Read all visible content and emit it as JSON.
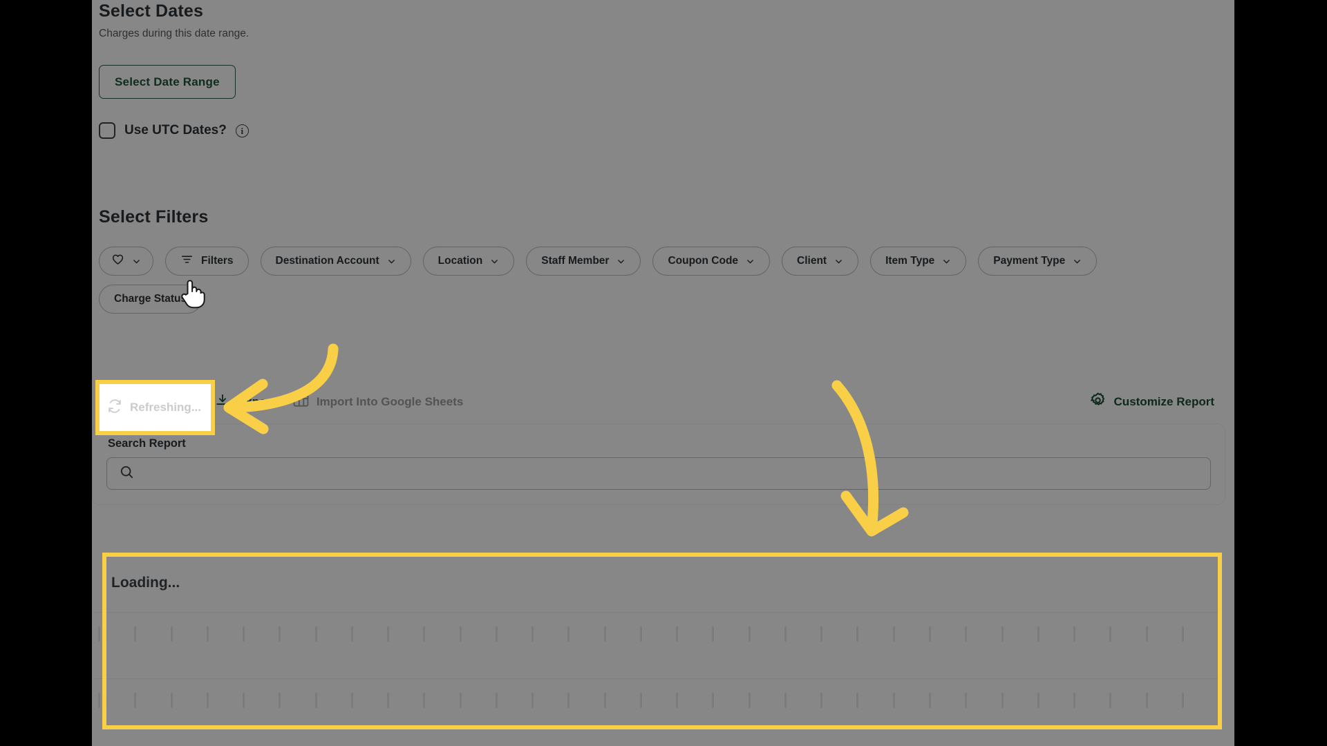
{
  "sections": {
    "dates": {
      "title": "Select Dates",
      "subtitle": "Charges during this date range.",
      "date_range_button": "Select Date Range",
      "utc_label": "Use UTC Dates?",
      "utc_checked": false,
      "info_glyph": "i"
    },
    "filters": {
      "title": "Select Filters",
      "pills": [
        {
          "label": "",
          "icon": "heart-icon",
          "chevron": true
        },
        {
          "label": "Filters",
          "icon": "filter-icon",
          "chevron": false
        },
        {
          "label": "Destination Account",
          "icon": "",
          "chevron": true
        },
        {
          "label": "Location",
          "icon": "",
          "chevron": true
        },
        {
          "label": "Staff Member",
          "icon": "",
          "chevron": true
        },
        {
          "label": "Coupon Code",
          "icon": "",
          "chevron": true
        },
        {
          "label": "Client",
          "icon": "",
          "chevron": true
        },
        {
          "label": "Item Type",
          "icon": "",
          "chevron": true
        },
        {
          "label": "Payment Type",
          "icon": "",
          "chevron": true
        },
        {
          "label": "Charge Status",
          "icon": "",
          "chevron": false
        }
      ]
    }
  },
  "toolbar": {
    "refreshing_label": "Refreshing...",
    "export_label": "Export",
    "sheets_label": "Import Into Google Sheets",
    "customize_label": "Customize Report"
  },
  "search": {
    "label": "Search Report",
    "value": "",
    "placeholder": ""
  },
  "results": {
    "loading_label": "Loading...",
    "skeleton_rows": 2,
    "skeleton_ticks": 31
  },
  "annotations": {
    "highlight_color": "#facf48",
    "arrow_color": "#facf48",
    "highlights": [
      {
        "name": "refreshing-highlight",
        "target": "Refreshing..."
      },
      {
        "name": "results-highlight",
        "target": "Loading..."
      }
    ]
  },
  "colors": {
    "brand_green": "#1c4f33",
    "text_dark": "#2e3338",
    "muted": "#9a9ea1",
    "pill_border": "#b9bcbe",
    "highlight_yellow": "#facf48",
    "scrim": "rgba(0,0,0,0.47)"
  }
}
